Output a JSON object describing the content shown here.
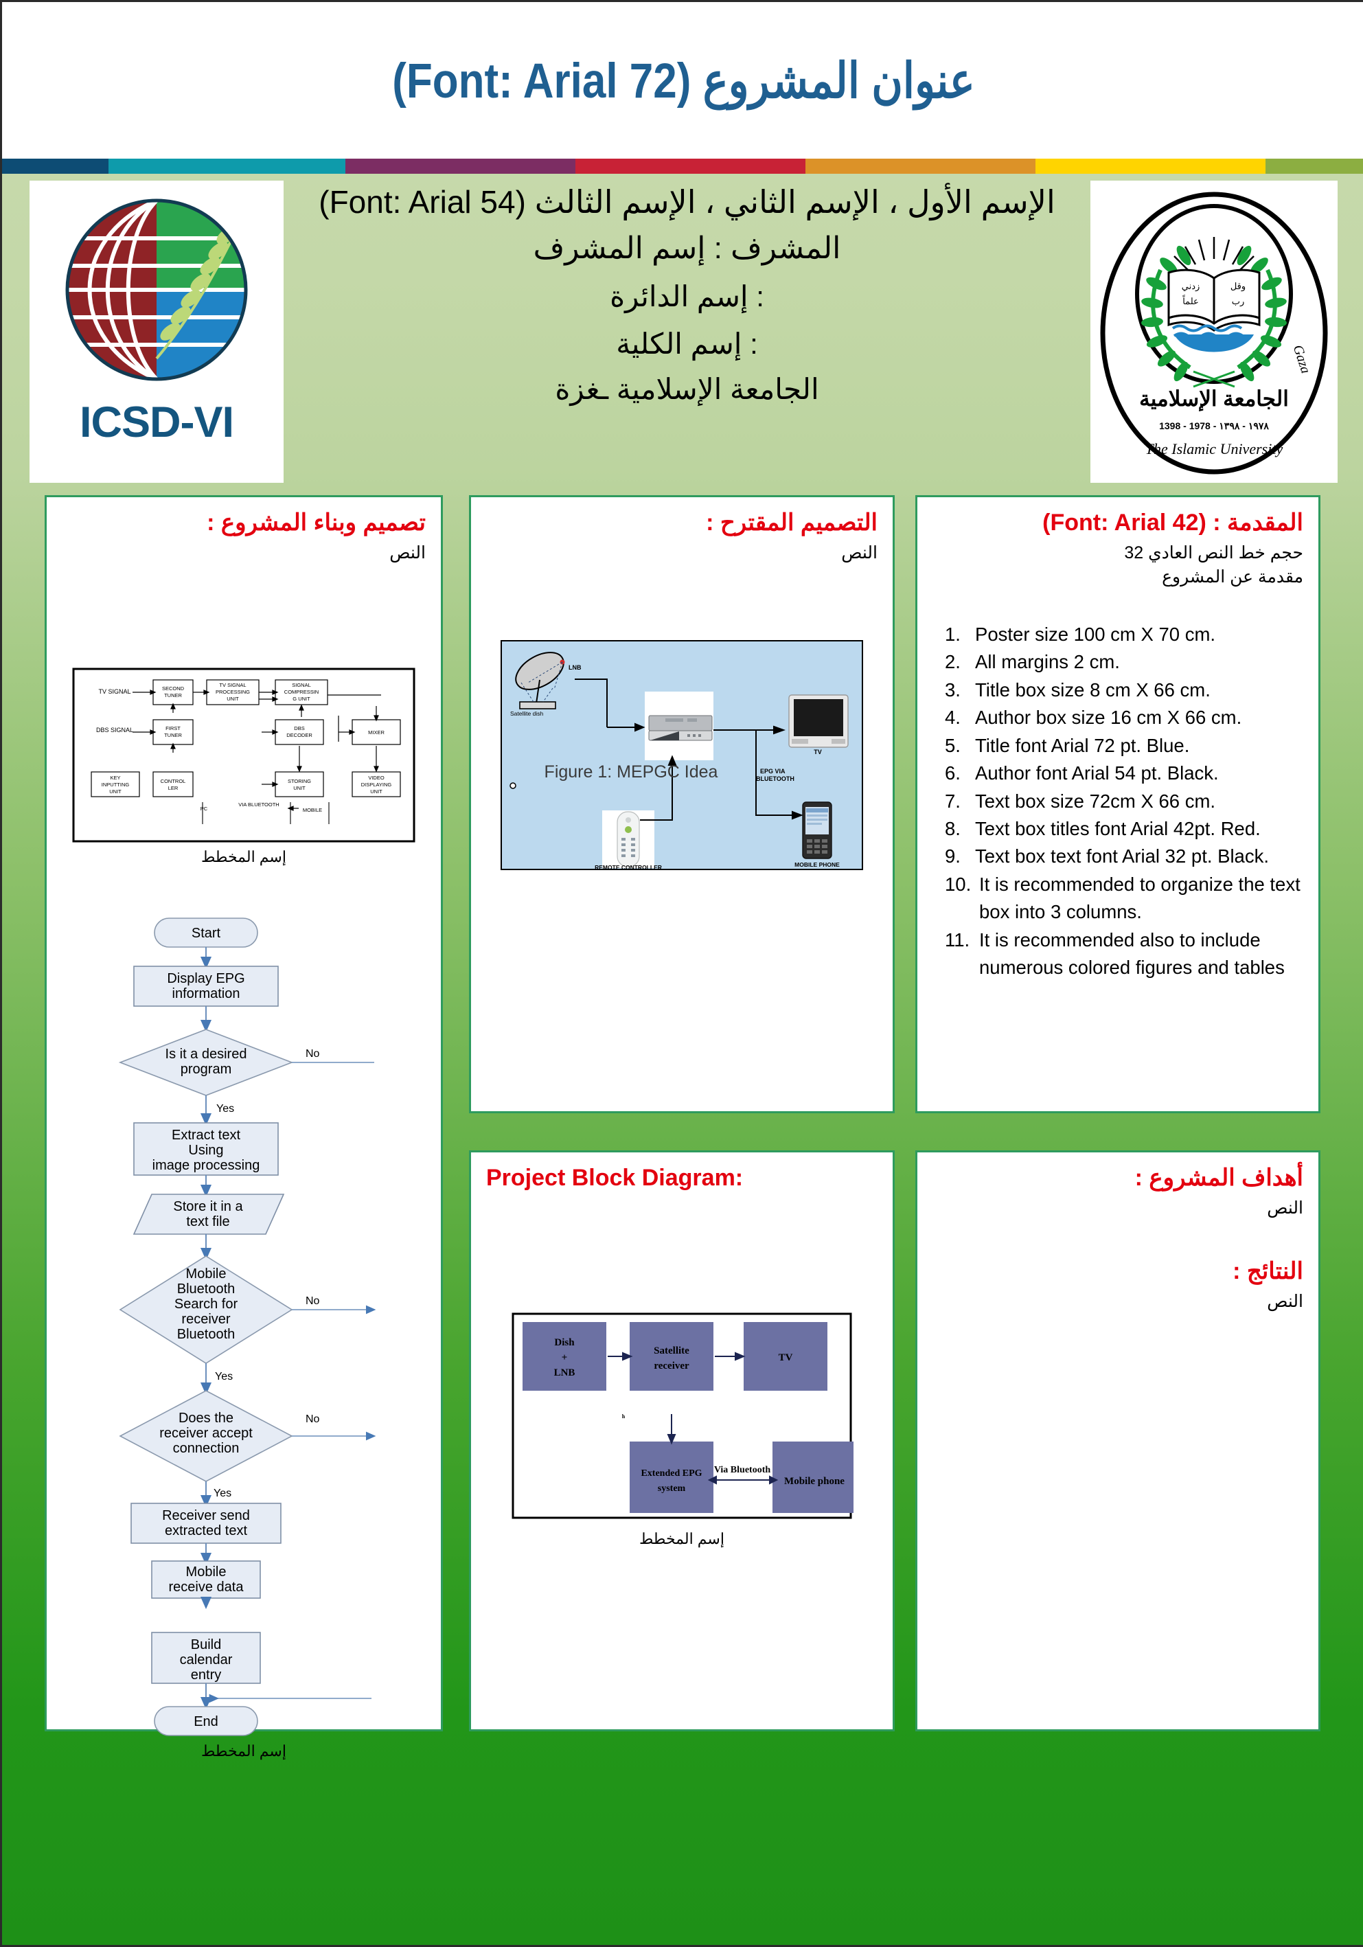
{
  "poster": {
    "title": "عنوان المشروع (Font: Arial 72)",
    "title_color": "#1f5f91",
    "section_title_color": "#e3000f",
    "panel_border_color": "#2e9b5e"
  },
  "stripe": {
    "colors": [
      "#0d4c74",
      "#0e9bab",
      "#7c2d63",
      "#c82236",
      "#dc9228",
      "#ffd400",
      "#8cae41"
    ]
  },
  "logos": {
    "left": {
      "name": "ICSD-VI",
      "label": "ICSD-VI",
      "label_color": "#14557f"
    },
    "right": {
      "name": "Islamic University of Gaza seal",
      "arabic_top": "الجامعة الإسلامية",
      "year_line": "1398 - 1978 - ١٩٧٨ - ١٣٩٨",
      "english_arc": "The Islamic University",
      "english_right": "Gaza",
      "book_text_right": "وقل",
      "book_text_right2": "رب",
      "book_text_left": "زدني",
      "book_text_left2": "علماً"
    }
  },
  "author_block": {
    "line1": "الإسم الأول ، الإسم الثاني ، الإسم الثالث (Font: Arial 54)",
    "line2": "المشرف : إسم المشرف",
    "line3": ": إسم الدائرة",
    "line4": ": إسم الكلية",
    "line5": "الجامعة الإسلامية ـغزة"
  },
  "panels": {
    "design_build": {
      "title": "تصميم وبناء المشروع :",
      "body": "النص",
      "diagram_caption": "إسم المخطط",
      "flowchart_caption": "إسم المخطط"
    },
    "proposed_design": {
      "title": "التصميم المقترح :",
      "body": "النص",
      "figure_caption": "Figure 1: MEPGC Idea"
    },
    "introduction": {
      "title": "المقدمة : (Font: Arial 42)",
      "sub1": "حجم خط النص العادي 32",
      "sub2": "مقدمة عن المشروع",
      "specs": [
        {
          "n": "1.",
          "text": "Poster size 100 cm X 70 cm."
        },
        {
          "n": "2.",
          "text": "All margins 2 cm."
        },
        {
          "n": "3.",
          "text": "Title box size 8 cm X 66 cm."
        },
        {
          "n": "4.",
          "text": "Author box size 16 cm X 66 cm."
        },
        {
          "n": "5.",
          "text": "Title font Arial 72 pt. Blue."
        },
        {
          "n": "6.",
          "text": "Author font Arial 54 pt. Black."
        },
        {
          "n": "7.",
          "text": "Text box size 72cm X 66 cm."
        },
        {
          "n": "8.",
          "text": "Text box titles font Arial 42pt. Red."
        },
        {
          "n": "9.",
          "text": "Text box text font Arial 32 pt. Black."
        },
        {
          "n": "10.",
          "text": "It is recommended to organize the text box into 3 columns."
        },
        {
          "n": "11.",
          "text": "It is recommended also to include numerous colored figures and tables"
        }
      ]
    },
    "block_diagram": {
      "title": "Project Block Diagram:",
      "caption": "إسم المخطط"
    },
    "objectives_results": {
      "objectives_title": "أهداف المشروع :",
      "objectives_body": "النص",
      "results_title": "النتائج :",
      "results_body": "النص"
    }
  },
  "figures": {
    "tv_block_diagram": {
      "blocks": [
        "TV SIGNAL",
        "SECOND TUNER",
        "TV SIGNAL PROCESSING UNIT",
        "SIGNAL COMPRESSING UNIT",
        "DBS SIGNAL",
        "FIRST TUNER",
        "DBS DECODER",
        "MIXER",
        "KEY INPUTTING UNIT",
        "CONTROL LER",
        "STORING UNIT",
        "VIDEO DISPLAYING UNIT",
        "PC",
        "VIA BLUETOOTH",
        "MOBILE"
      ],
      "labels": {
        "tv_signal": "TV SIGNAL",
        "second_tuner_1": "SECOND",
        "second_tuner_2": "TUNER",
        "tv_proc_1": "TV SIGNAL",
        "tv_proc_2": "PROCESSING",
        "tv_proc_3": "UNIT",
        "compress_1": "SIGNAL",
        "compress_2": "COMPRESSIN",
        "compress_3": "G UNIT",
        "dbs_signal": "DBS SIGNAL",
        "first_tuner_1": "FIRST",
        "first_tuner_2": "TUNER",
        "dbs_dec_1": "DBS",
        "dbs_dec_2": "DECODER",
        "mixer": "MIXER",
        "key_1": "KEY",
        "key_2": "INPUTTING",
        "key_3": "UNIT",
        "ctrl_1": "CONTROL",
        "ctrl_2": "LER",
        "store_1": "STORING",
        "store_2": "UNIT",
        "video_1": "VIDEO",
        "video_2": "DISPLAYING",
        "video_3": "UNIT",
        "pc": "PC",
        "via_bt": "VIA BLUETOOTH",
        "mobile": "MOBILE"
      }
    },
    "flowchart": {
      "nodes": [
        {
          "id": "start",
          "shape": "terminator",
          "text": "Start"
        },
        {
          "id": "display",
          "shape": "process",
          "text": "Display EPG information"
        },
        {
          "id": "desired",
          "shape": "decision",
          "text": "Is it a desired program"
        },
        {
          "id": "extract",
          "shape": "process",
          "text": "Extract text Using image processing"
        },
        {
          "id": "store",
          "shape": "data",
          "text": "Store it in a text file"
        },
        {
          "id": "search",
          "shape": "decision",
          "text": "Mobile Bluetooth Search for receiver Bluetooth"
        },
        {
          "id": "accept",
          "shape": "decision",
          "text": "Does the receiver accept connection"
        },
        {
          "id": "send",
          "shape": "process",
          "text": "Receiver send extracted text"
        },
        {
          "id": "receive",
          "shape": "process",
          "text": "Mobile receive data"
        },
        {
          "id": "build",
          "shape": "process",
          "text": "Build calendar entry"
        },
        {
          "id": "end",
          "shape": "terminator",
          "text": "End"
        }
      ],
      "edge_labels": {
        "yes": "Yes",
        "no": "No"
      },
      "node_text": {
        "start": "Start",
        "display_1": "Display EPG",
        "display_2": "information",
        "desired_1": "Is it a desired",
        "desired_2": "program",
        "extract_1": "Extract text",
        "extract_2": "Using",
        "extract_3": "image processing",
        "store_1": "Store it in a",
        "store_2": "text file",
        "search_1": "Mobile",
        "search_2": "Bluetooth",
        "search_3": "Search for",
        "search_4": "receiver",
        "search_5": "Bluetooth",
        "accept_1": "Does the",
        "accept_2": "receiver accept",
        "accept_3": "connection",
        "send_1": "Receiver send",
        "send_2": "extracted text",
        "receive_1": "Mobile",
        "receive_2": "receive data",
        "build_1": "Build",
        "build_2": "calendar",
        "build_3": "entry",
        "end": "End"
      }
    },
    "mepgc": {
      "caption": "Figure 1: MEPGC Idea",
      "labels": {
        "lnb": "LNB",
        "dish": "Satellite dish",
        "tv": "TV",
        "epg_via_1": "EPG VIA",
        "epg_via_2": "BLUETOOTH",
        "mobile_phone": "MOBILE PHONE",
        "remote": "REMOTE CONTROLLER"
      },
      "bg_color": "#bcd9ee"
    },
    "project_blocks": {
      "fill_color": "#6c71a3",
      "labels": {
        "dish_1": "Dish",
        "dish_2": "+",
        "dish_3": "LNB",
        "receiver_1": "Satellite",
        "receiver_2": "receiver",
        "tv": "TV",
        "epg_1": "Extended EPG",
        "epg_2": "system",
        "bluetooth": "Via Bluetooth",
        "mobile": "Mobile phone",
        "stray": "h"
      }
    }
  }
}
